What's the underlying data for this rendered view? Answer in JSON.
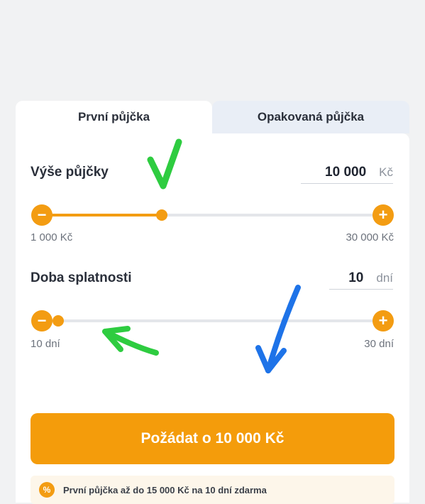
{
  "tabs": [
    {
      "label": "První půjčka",
      "active": true
    },
    {
      "label": "Opakovaná půjčka",
      "active": false
    }
  ],
  "loan_amount": {
    "label": "Výše půjčky",
    "value": "10 000",
    "unit": "Kč",
    "min_label": "1 000 Kč",
    "max_label": "30 000 Kč",
    "min": 1000,
    "max": 30000,
    "current": 10000
  },
  "repayment": {
    "label": "Doba splatnosti",
    "value": "10",
    "unit": "dní",
    "min_label": "10 dní",
    "max_label": "30 dní",
    "min": 10,
    "max": 30,
    "current": 10
  },
  "buttons": {
    "minus": "−",
    "plus": "+"
  },
  "cta": {
    "label": "Požádat o 10 000 Kč"
  },
  "promo": {
    "icon_symbol": "%",
    "text": "První půjčka až do 15 000 Kč na 10 dní zdarma"
  },
  "colors": {
    "accent": "#f39c12",
    "annotation_green": "#2ecc40",
    "annotation_blue": "#1e73e8"
  }
}
